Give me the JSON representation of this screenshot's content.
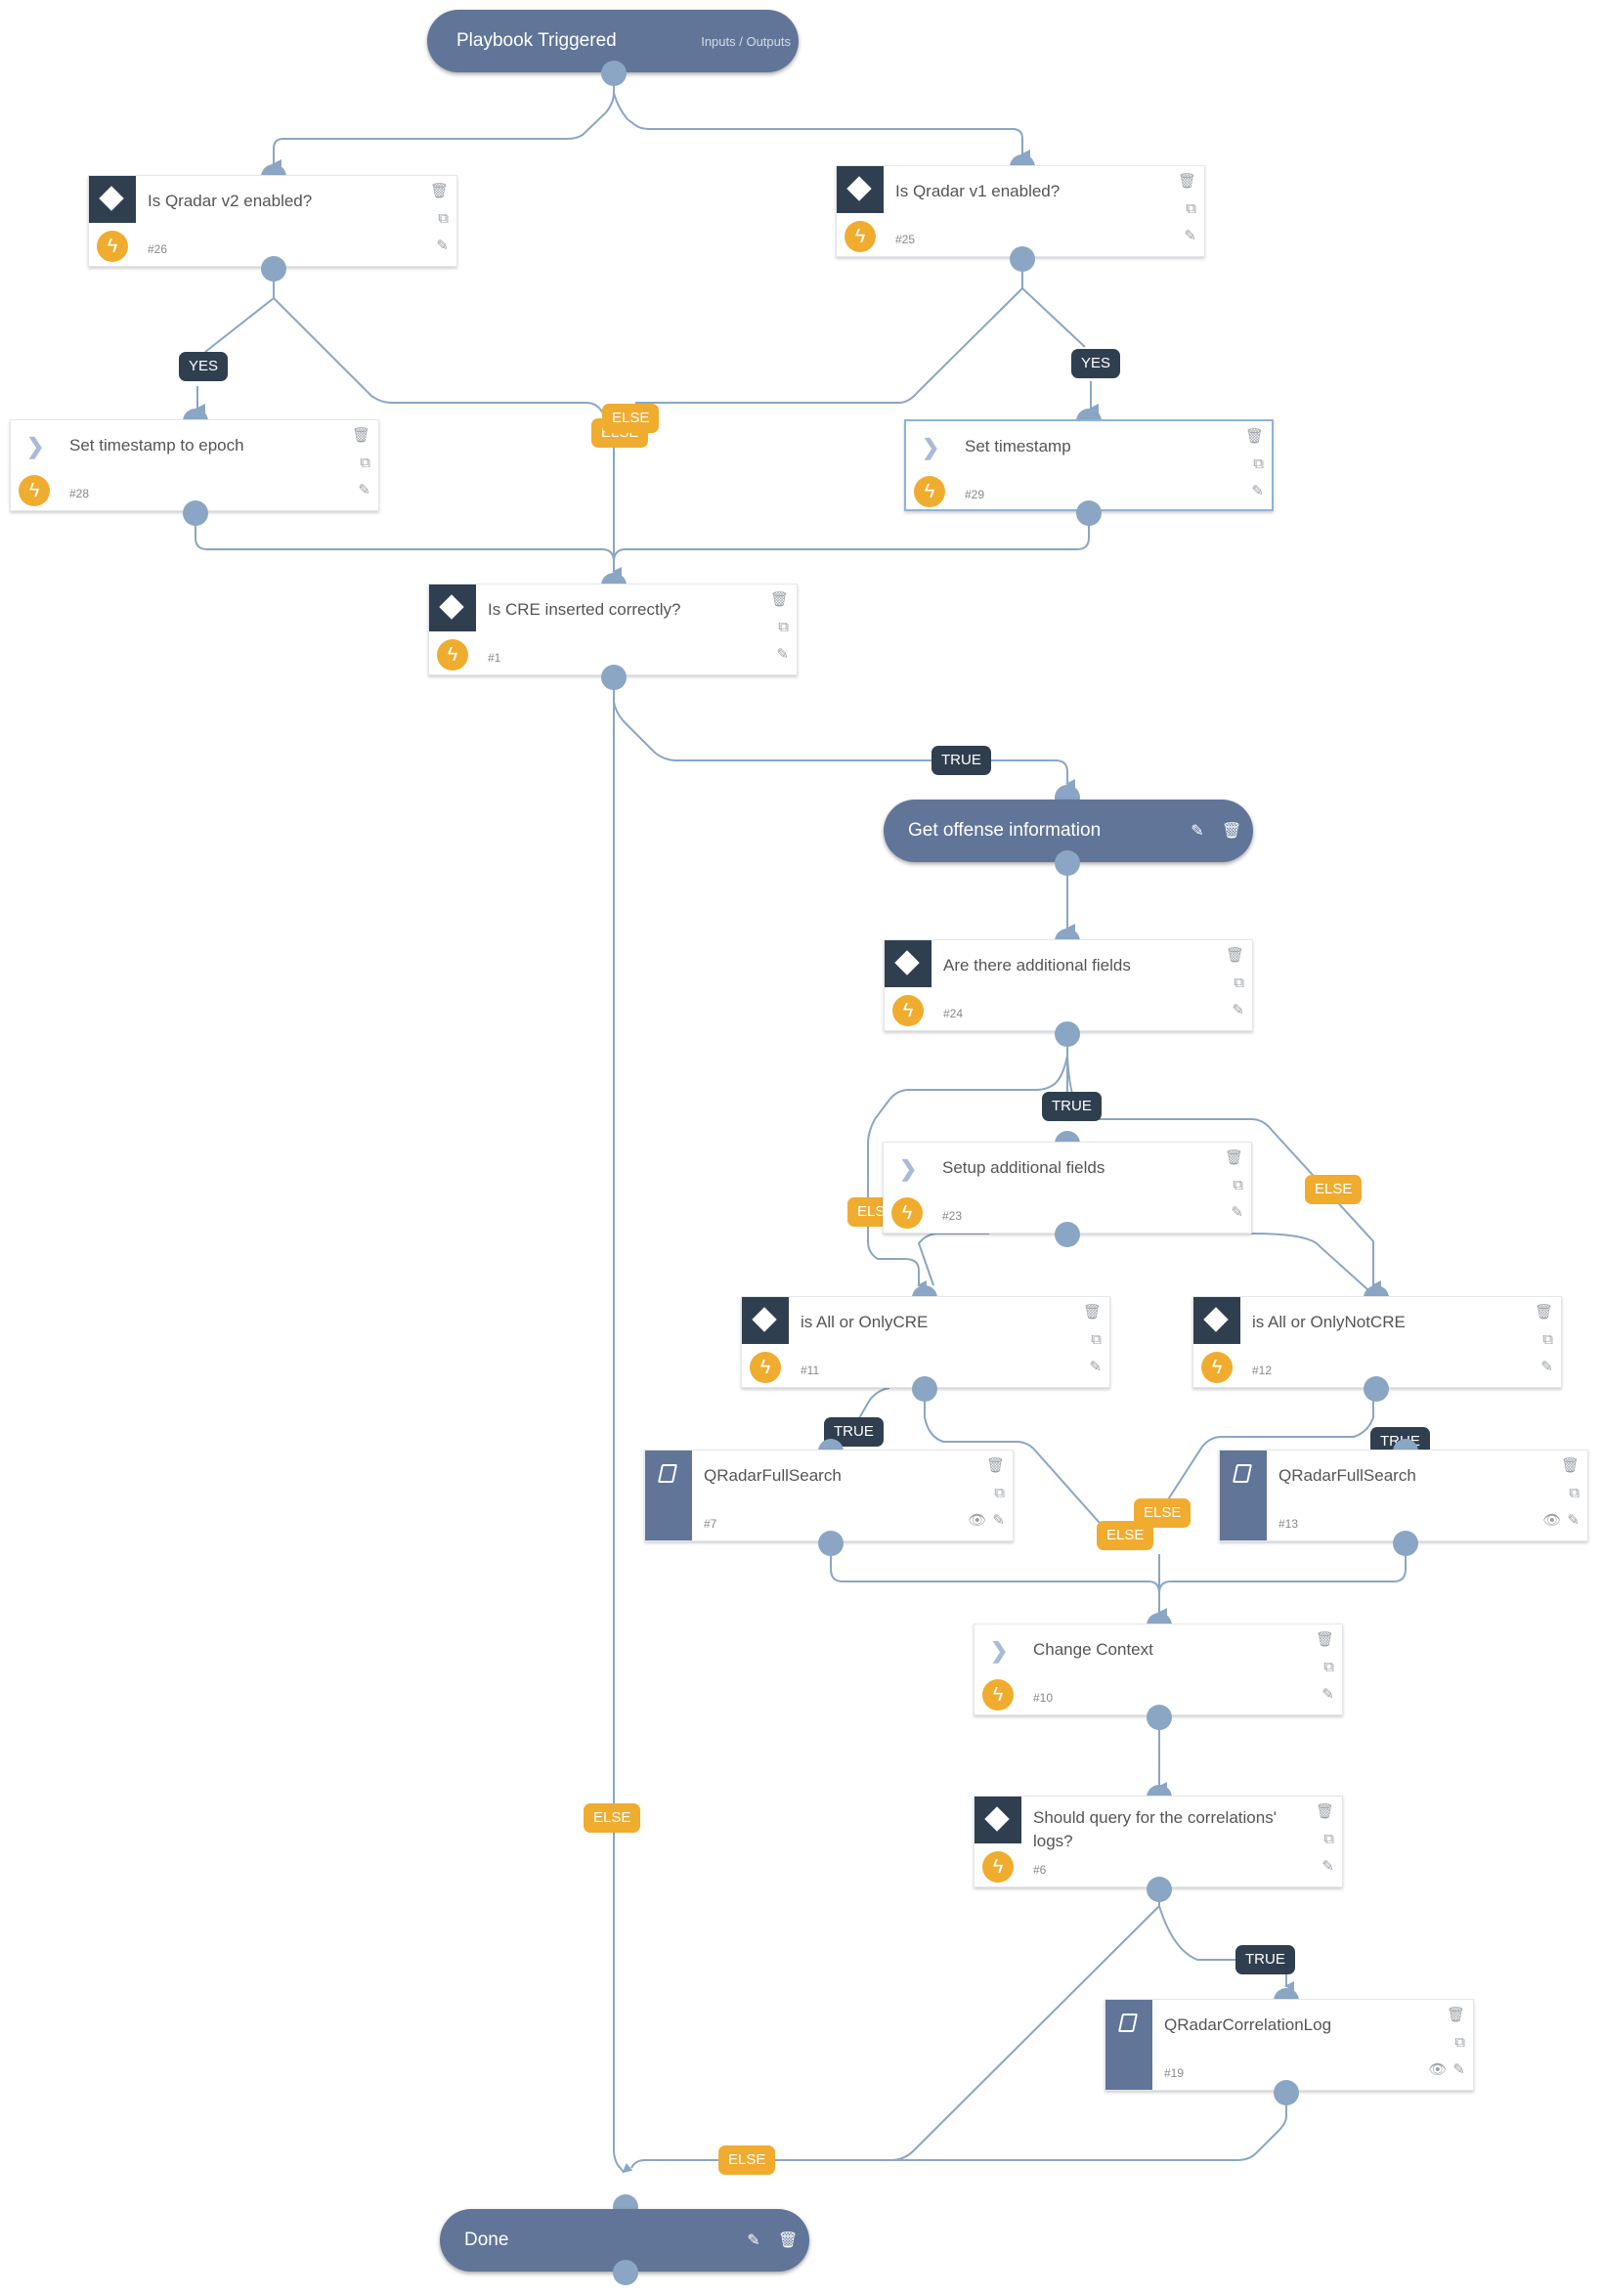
{
  "colors": {
    "edge": "#8aa6c4",
    "pill": "#617599",
    "condition": "#2f3f4f",
    "automation": "#f0ac2f",
    "label_dark": "#2f3f4f",
    "label_else": "#f0ac2f"
  },
  "start": {
    "title": "Playbook Triggered",
    "io_link": "Inputs / Outputs"
  },
  "sections": {
    "get_offense": {
      "title": "Get offense information",
      "icons": [
        "edit-icon",
        "trash-icon"
      ]
    },
    "done": {
      "title": "Done",
      "icons": [
        "edit-icon",
        "trash-icon"
      ]
    }
  },
  "nodes": [
    {
      "id": "n26",
      "type": "condition",
      "name": "Is Qradar v2 enabled?",
      "number": "#26"
    },
    {
      "id": "n25",
      "type": "condition",
      "name": "Is Qradar v1 enabled?",
      "number": "#25"
    },
    {
      "id": "n28",
      "type": "regular",
      "name": "Set timestamp to epoch",
      "number": "#28"
    },
    {
      "id": "n29",
      "type": "regular",
      "name": "Set timestamp",
      "number": "#29",
      "selected": true
    },
    {
      "id": "n1",
      "type": "condition",
      "name": "Is CRE inserted correctly?",
      "number": "#1"
    },
    {
      "id": "n24",
      "type": "condition",
      "name": "Are there additional fields",
      "number": "#24"
    },
    {
      "id": "n23",
      "type": "regular",
      "name": "Setup additional fields",
      "number": "#23"
    },
    {
      "id": "n11",
      "type": "condition",
      "name": "is All or OnlyCRE",
      "number": "#11"
    },
    {
      "id": "n12",
      "type": "condition",
      "name": "is All or OnlyNotCRE",
      "number": "#12"
    },
    {
      "id": "n7",
      "type": "playbook",
      "name": "QRadarFullSearch",
      "number": "#7"
    },
    {
      "id": "n13",
      "type": "playbook",
      "name": "QRadarFullSearch",
      "number": "#13"
    },
    {
      "id": "n10",
      "type": "regular",
      "name": "Change Context",
      "number": "#10"
    },
    {
      "id": "n6",
      "type": "condition",
      "name": "Should query for the correlations' logs?",
      "number": "#6"
    },
    {
      "id": "n19",
      "type": "playbook",
      "name": "QRadarCorrelationLog",
      "number": "#19"
    }
  ],
  "edge_labels": [
    {
      "text": "YES",
      "kind": "dark"
    },
    {
      "text": "YES",
      "kind": "dark"
    },
    {
      "text": "ELSE",
      "kind": "orange"
    },
    {
      "text": "ELSE",
      "kind": "orange"
    },
    {
      "text": "TRUE",
      "kind": "dark"
    },
    {
      "text": "TRUE",
      "kind": "dark"
    },
    {
      "text": "ELSE",
      "kind": "orange"
    },
    {
      "text": "ELSE",
      "kind": "orange"
    },
    {
      "text": "TRUE",
      "kind": "dark"
    },
    {
      "text": "TRUE",
      "kind": "dark"
    },
    {
      "text": "ELSE",
      "kind": "orange"
    },
    {
      "text": "ELSE",
      "kind": "orange"
    },
    {
      "text": "ELSE",
      "kind": "orange"
    },
    {
      "text": "TRUE",
      "kind": "dark"
    },
    {
      "text": "ELSE",
      "kind": "orange"
    }
  ]
}
